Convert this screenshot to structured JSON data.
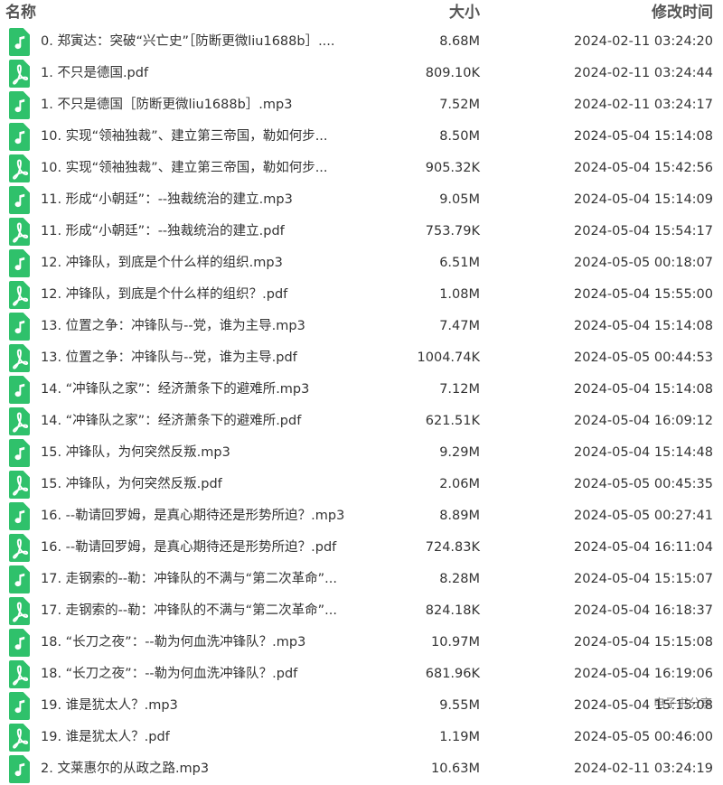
{
  "header": {
    "name_label": "名称",
    "size_label": "大小",
    "time_label": "修改时间"
  },
  "colors": {
    "file_icon": "#2fc16b"
  },
  "watermark": "电子书分享",
  "files": [
    {
      "name": "0. 郑寅达：突破“兴亡史”［防断更微liu1688b］....",
      "size": "8.68M",
      "time": "2024-02-11 03:24:20",
      "icon": "audio-file-icon"
    },
    {
      "name": "1. 不只是德国.pdf",
      "size": "809.10K",
      "time": "2024-02-11 03:24:44",
      "icon": "pdf-file-icon"
    },
    {
      "name": "1. 不只是德国［防断更微liu1688b］.mp3",
      "size": "7.52M",
      "time": "2024-02-11 03:24:17",
      "icon": "audio-file-icon"
    },
    {
      "name": "10. 实现“领袖独裁”、建立第三帝国，勒如何步...",
      "size": "8.50M",
      "time": "2024-05-04 15:14:08",
      "icon": "audio-file-icon"
    },
    {
      "name": "10. 实现“领袖独裁”、建立第三帝国，勒如何步...",
      "size": "905.32K",
      "time": "2024-05-04 15:42:56",
      "icon": "pdf-file-icon"
    },
    {
      "name": "11. 形成“小朝廷”：--独裁统治的建立.mp3",
      "size": "9.05M",
      "time": "2024-05-04 15:14:09",
      "icon": "audio-file-icon"
    },
    {
      "name": "11. 形成“小朝廷”：--独裁统治的建立.pdf",
      "size": "753.79K",
      "time": "2024-05-04 15:54:17",
      "icon": "pdf-file-icon"
    },
    {
      "name": "12. 冲锋队，到底是个什么样的组织.mp3",
      "size": "6.51M",
      "time": "2024-05-05 00:18:07",
      "icon": "audio-file-icon"
    },
    {
      "name": "12. 冲锋队，到底是个什么样的组织？.pdf",
      "size": "1.08M",
      "time": "2024-05-04 15:55:00",
      "icon": "pdf-file-icon"
    },
    {
      "name": "13. 位置之争：冲锋队与--党，谁为主导.mp3",
      "size": "7.47M",
      "time": "2024-05-04 15:14:08",
      "icon": "audio-file-icon"
    },
    {
      "name": "13. 位置之争：冲锋队与--党，谁为主导.pdf",
      "size": "1004.74K",
      "time": "2024-05-05 00:44:53",
      "icon": "pdf-file-icon"
    },
    {
      "name": "14. “冲锋队之家”：经济萧条下的避难所.mp3",
      "size": "7.12M",
      "time": "2024-05-04 15:14:08",
      "icon": "audio-file-icon"
    },
    {
      "name": "14. “冲锋队之家”：经济萧条下的避难所.pdf",
      "size": "621.51K",
      "time": "2024-05-04 16:09:12",
      "icon": "pdf-file-icon"
    },
    {
      "name": "15. 冲锋队，为何突然反叛.mp3",
      "size": "9.29M",
      "time": "2024-05-04 15:14:48",
      "icon": "audio-file-icon"
    },
    {
      "name": "15. 冲锋队，为何突然反叛.pdf",
      "size": "2.06M",
      "time": "2024-05-05 00:45:35",
      "icon": "pdf-file-icon"
    },
    {
      "name": "16. --勒请回罗姆，是真心期待还是形势所迫？.mp3",
      "size": "8.89M",
      "time": "2024-05-05 00:27:41",
      "icon": "audio-file-icon"
    },
    {
      "name": "16. --勒请回罗姆，是真心期待还是形势所迫？.pdf",
      "size": "724.83K",
      "time": "2024-05-04 16:11:04",
      "icon": "pdf-file-icon"
    },
    {
      "name": "17. 走钢索的--勒：冲锋队的不满与“第二次革命”...",
      "size": "8.28M",
      "time": "2024-05-04 15:15:07",
      "icon": "audio-file-icon"
    },
    {
      "name": "17. 走钢索的--勒：冲锋队的不满与“第二次革命”...",
      "size": "824.18K",
      "time": "2024-05-04 16:18:37",
      "icon": "pdf-file-icon"
    },
    {
      "name": "18. “长刀之夜”：--勒为何血洗冲锋队？.mp3",
      "size": "10.97M",
      "time": "2024-05-04 15:15:08",
      "icon": "audio-file-icon"
    },
    {
      "name": "18. “长刀之夜”：--勒为何血洗冲锋队？.pdf",
      "size": "681.96K",
      "time": "2024-05-04 16:19:06",
      "icon": "pdf-file-icon"
    },
    {
      "name": "19. 谁是犹太人？.mp3",
      "size": "9.55M",
      "time": "2024-05-04 15:15:08",
      "icon": "audio-file-icon"
    },
    {
      "name": "19. 谁是犹太人？.pdf",
      "size": "1.19M",
      "time": "2024-05-05 00:46:00",
      "icon": "pdf-file-icon"
    },
    {
      "name": "2. 文莱惠尔的从政之路.mp3",
      "size": "10.63M",
      "time": "2024-02-11 03:24:19",
      "icon": "audio-file-icon"
    }
  ]
}
